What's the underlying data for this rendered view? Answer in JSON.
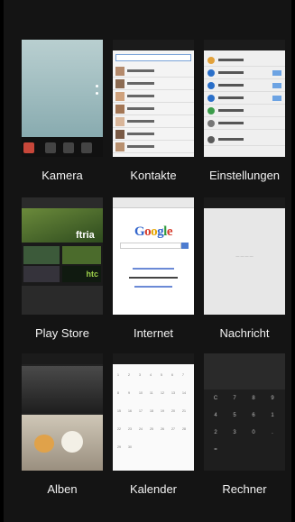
{
  "apps": [
    {
      "name": "Kamera"
    },
    {
      "name": "Kontakte"
    },
    {
      "name": "Einstellungen"
    },
    {
      "name": "Play Store"
    },
    {
      "name": "Internet"
    },
    {
      "name": "Nachricht"
    },
    {
      "name": "Alben"
    },
    {
      "name": "Kalender"
    },
    {
      "name": "Rechner"
    }
  ],
  "internet": {
    "logo": "Google"
  },
  "playstore": {
    "brand": "htc"
  },
  "calendar": {
    "days": [
      "1",
      "2",
      "3",
      "4",
      "5",
      "6",
      "7",
      "8",
      "9",
      "10",
      "11",
      "12",
      "13",
      "14",
      "15",
      "16",
      "17",
      "18",
      "19",
      "20",
      "21",
      "22",
      "23",
      "24",
      "25",
      "26",
      "27",
      "28",
      "29",
      "30"
    ]
  },
  "calculator": {
    "keys": [
      "C",
      "7",
      "8",
      "9",
      "4",
      "5",
      "6",
      "1",
      "2",
      "3",
      "0",
      ".",
      "="
    ]
  }
}
